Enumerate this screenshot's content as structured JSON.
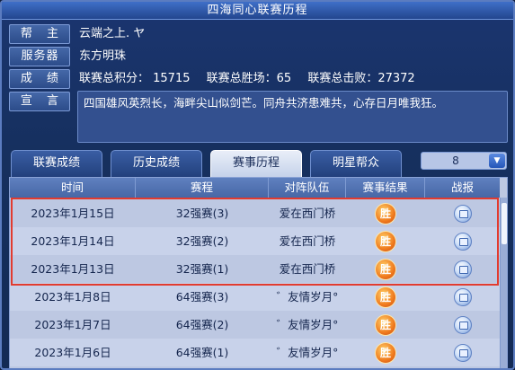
{
  "window": {
    "title": "四海同心联赛历程"
  },
  "info": {
    "leader_label": "帮 主",
    "leader_value": "云端之上. ヤ",
    "server_label": "服务器",
    "server_value": "东方明珠",
    "score_label": "成 绩",
    "stats": {
      "total_points": "联赛总积分： 15715",
      "total_wins": "联赛总胜场：65",
      "total_losses": "联赛总击败：27372"
    },
    "declaration_label": "宣 言",
    "declaration_text": "四国雄风英烈长，海畔尖山似剑芒。同舟共济患难共，心存日月唯我狂。"
  },
  "tabs": [
    {
      "label": "联赛成绩",
      "active": false
    },
    {
      "label": "历史成绩",
      "active": false
    },
    {
      "label": "赛事历程",
      "active": true
    },
    {
      "label": "明星帮众",
      "active": false
    }
  ],
  "page_select": {
    "value": "8",
    "icon": "chevron-down-icon"
  },
  "table": {
    "headers": [
      "时间",
      "赛程",
      "对阵队伍",
      "赛事结果",
      "战报"
    ],
    "rows": [
      {
        "date": "2023年1月15日",
        "round": "32强赛(3)",
        "opponent": "爱在西门桥",
        "result": "胜"
      },
      {
        "date": "2023年1月14日",
        "round": "32强赛(2)",
        "opponent": "爱在西门桥",
        "result": "胜"
      },
      {
        "date": "2023年1月13日",
        "round": "32强赛(1)",
        "opponent": "爱在西门桥",
        "result": "胜"
      },
      {
        "date": "2023年1月8日",
        "round": "64强赛(3)",
        "opponent": "゛友情岁月°",
        "result": "胜"
      },
      {
        "date": "2023年1月7日",
        "round": "64强赛(2)",
        "opponent": "゛友情岁月°",
        "result": "胜"
      },
      {
        "date": "2023年1月6日",
        "round": "64强赛(1)",
        "opponent": "゛友情岁月°",
        "result": "胜"
      }
    ]
  },
  "colors": {
    "highlight": "#e23b2f",
    "win_badge": "#f07a1d"
  }
}
